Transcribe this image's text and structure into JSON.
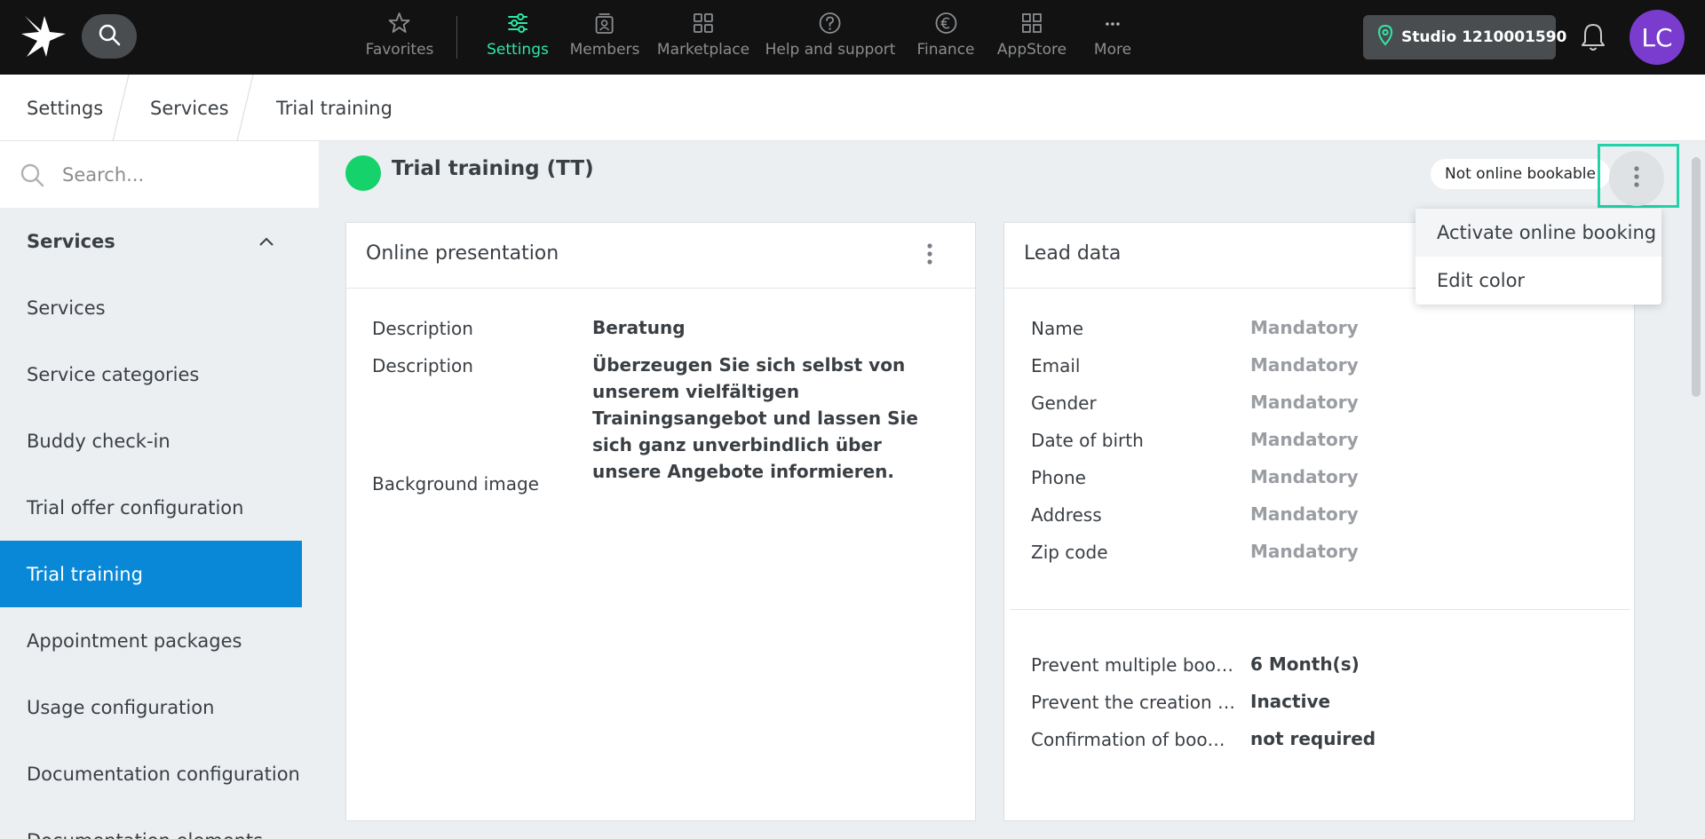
{
  "colors": {
    "topbar_bg": "#121212",
    "accent_active": "#2ee8a5",
    "sidebar_active": "#0a88d8",
    "status_dot": "#15d26a",
    "avatar_bg": "#7a3ccf",
    "highlight": "#22d2a8"
  },
  "topbar": {
    "logo_icon": "star-logo-icon",
    "search_icon": "search-icon",
    "nav": [
      {
        "label": "Favorites",
        "icon": "star-icon"
      },
      {
        "label": "Settings",
        "icon": "sliders-icon",
        "active": true
      },
      {
        "label": "Members",
        "icon": "members-icon"
      },
      {
        "label": "Marketplace",
        "icon": "grid-icon"
      },
      {
        "label": "Help and support",
        "icon": "help-icon"
      },
      {
        "label": "Finance",
        "icon": "euro-icon"
      },
      {
        "label": "AppStore",
        "icon": "apps-icon"
      },
      {
        "label": "More",
        "icon": "more-icon"
      }
    ],
    "studio": "Studio 1210001590",
    "bell_icon": "bell-icon",
    "avatar_initials": "LC"
  },
  "breadcrumb": [
    "Settings",
    "Services",
    "Trial training"
  ],
  "sidebar": {
    "search_placeholder": "Search...",
    "group_label": "Services",
    "items": [
      "Services",
      "Service categories",
      "Buddy check-in",
      "Trial offer configuration",
      "Trial training",
      "Appointment packages",
      "Usage configuration",
      "Documentation configuration",
      "Documentation elements"
    ],
    "active_item": "Trial training"
  },
  "main": {
    "title": "Trial training (TT)",
    "online_status": "Not online bookable",
    "menu": [
      "Activate online booking",
      "Edit color"
    ]
  },
  "online_presentation": {
    "title": "Online presentation",
    "rows": [
      {
        "label": "Description",
        "value": "Beratung"
      },
      {
        "label": "Description",
        "value": "Überzeugen Sie sich selbst von unserem vielfältigen Trainingsangebot und lassen Sie sich ganz unverbindlich über unsere Angebote informieren."
      },
      {
        "label": "Background image",
        "value": ""
      }
    ]
  },
  "lead_data": {
    "title": "Lead data",
    "fields": [
      {
        "label": "Name",
        "value": "Mandatory"
      },
      {
        "label": "Email",
        "value": "Mandatory"
      },
      {
        "label": "Gender",
        "value": "Mandatory"
      },
      {
        "label": "Date of birth",
        "value": "Mandatory"
      },
      {
        "label": "Phone",
        "value": "Mandatory"
      },
      {
        "label": "Address",
        "value": "Mandatory"
      },
      {
        "label": "Zip code",
        "value": "Mandatory"
      }
    ],
    "settings": [
      {
        "label": "Prevent multiple boo…",
        "value": "6 Month(s)"
      },
      {
        "label": "Prevent the creation …",
        "value": "Inactive"
      },
      {
        "label": "Confirmation of boo…",
        "value": "not required"
      }
    ]
  }
}
